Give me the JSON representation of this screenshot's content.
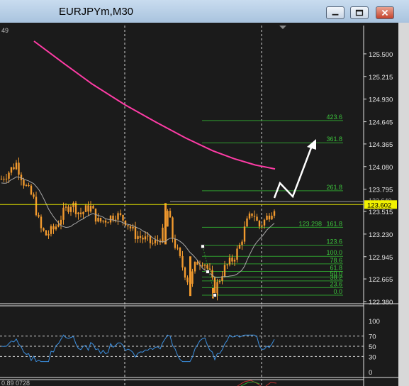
{
  "window": {
    "title": "EURJPYm,M30"
  },
  "main_panel": {
    "top_left_label": "49",
    "price_axis_labels": [
      "125.500",
      "125.215",
      "124.930",
      "124.645",
      "124.365",
      "124.080",
      "123.795",
      "123.515",
      "123.230",
      "122.945",
      "122.665",
      "122.380"
    ],
    "price_top": 125.66,
    "price_bottom": 122.38,
    "current_price_label": "123.602",
    "current_price": 123.602,
    "partial_ask_label": "123.640",
    "partial_ask_price": 123.64,
    "fibonacci": {
      "from_price": 122.46,
      "to_price": 123.075,
      "levels": [
        {
          "label": "423.6",
          "price": 124.66
        },
        {
          "label": "361.8",
          "price": 124.38
        },
        {
          "label": "261.8",
          "price": 123.775
        },
        {
          "label": "161.8",
          "price": 123.315,
          "value_label": "123.298"
        },
        {
          "label": "123.6",
          "price": 123.09
        },
        {
          "label": "100.0",
          "price": 122.95
        },
        {
          "label": "78.6",
          "price": 122.855
        },
        {
          "label": "61.8",
          "price": 122.76
        },
        {
          "label": "50.0",
          "price": 122.69
        },
        {
          "label": "38.2",
          "price": 122.64
        },
        {
          "label": "23.6",
          "price": 122.555
        },
        {
          "label": "0.0",
          "price": 122.46
        }
      ]
    }
  },
  "rsi_panel": {
    "levels": [
      70,
      50,
      30
    ],
    "axis_labels": [
      "100",
      "70",
      "50",
      "30",
      "0"
    ]
  },
  "bottom_panel": {
    "label": "0.89 0728"
  },
  "colors": {
    "background": "#1b1b1b",
    "candle": "#f29a2e",
    "ma_slow": "#ff3ca6",
    "ma_fast": "#a8a8a8",
    "fib": "#2e9a2e",
    "fib_text": "#3cc43c",
    "current_price_line": "#e6e600",
    "rsi": "#3b8fe0",
    "arrow": "#ffffff"
  }
}
